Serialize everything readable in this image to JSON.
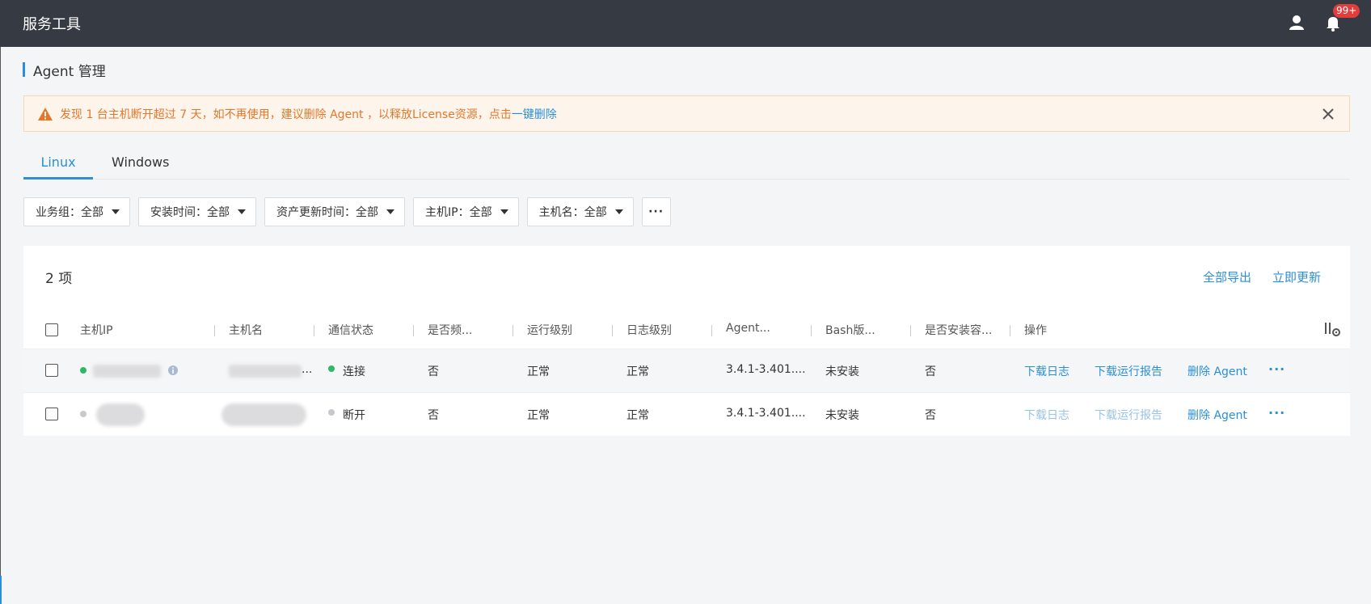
{
  "app": {
    "title": "服务工具",
    "notification_count": "99+"
  },
  "page": {
    "heading": "Agent 管理"
  },
  "alert": {
    "message": "发现 1 台主机断开超过 7 天，如不再使用，建议删除 Agent ，以释放License资源，点击",
    "link": "一键删除"
  },
  "tabs": [
    {
      "label": "Linux",
      "active": true
    },
    {
      "label": "Windows",
      "active": false
    }
  ],
  "filters": [
    {
      "label": "业务组：全部"
    },
    {
      "label": "安装时间：全部"
    },
    {
      "label": "资产更新时间：全部"
    },
    {
      "label": "主机IP：全部"
    },
    {
      "label": "主机名：全部"
    },
    {
      "label": "···"
    }
  ],
  "table": {
    "count_label": "2 项",
    "top_actions": {
      "export_all": "全部导出",
      "update_now": "立即更新"
    },
    "columns": [
      "主机IP",
      "主机名",
      "通信状态",
      "是否频...",
      "运行级别",
      "日志级别",
      "Agent...",
      "Bash版...",
      "是否安装容...",
      "操作"
    ],
    "rows": [
      {
        "comm_status": "连接",
        "frequent": "否",
        "run_level": "正常",
        "log_level": "正常",
        "agent": "3.4.1-3.401....",
        "bash": "未安装",
        "container": "否",
        "actions": {
          "download_log": "下载日志",
          "download_report": "下载运行报告",
          "delete_agent": "删除 Agent",
          "more": "···"
        }
      },
      {
        "comm_status": "断开",
        "frequent": "否",
        "run_level": "正常",
        "log_level": "正常",
        "agent": "3.4.1-3.401....",
        "bash": "未安装",
        "container": "否",
        "actions": {
          "download_log": "下载日志",
          "download_report": "下载运行报告",
          "delete_agent": "删除 Agent",
          "more": "···"
        }
      }
    ]
  },
  "colors": {
    "accent": "#2a8fd8",
    "warning": "#e6762a",
    "topbar": "#363a42",
    "online": "#2db968",
    "offline": "#c6c8cc"
  }
}
